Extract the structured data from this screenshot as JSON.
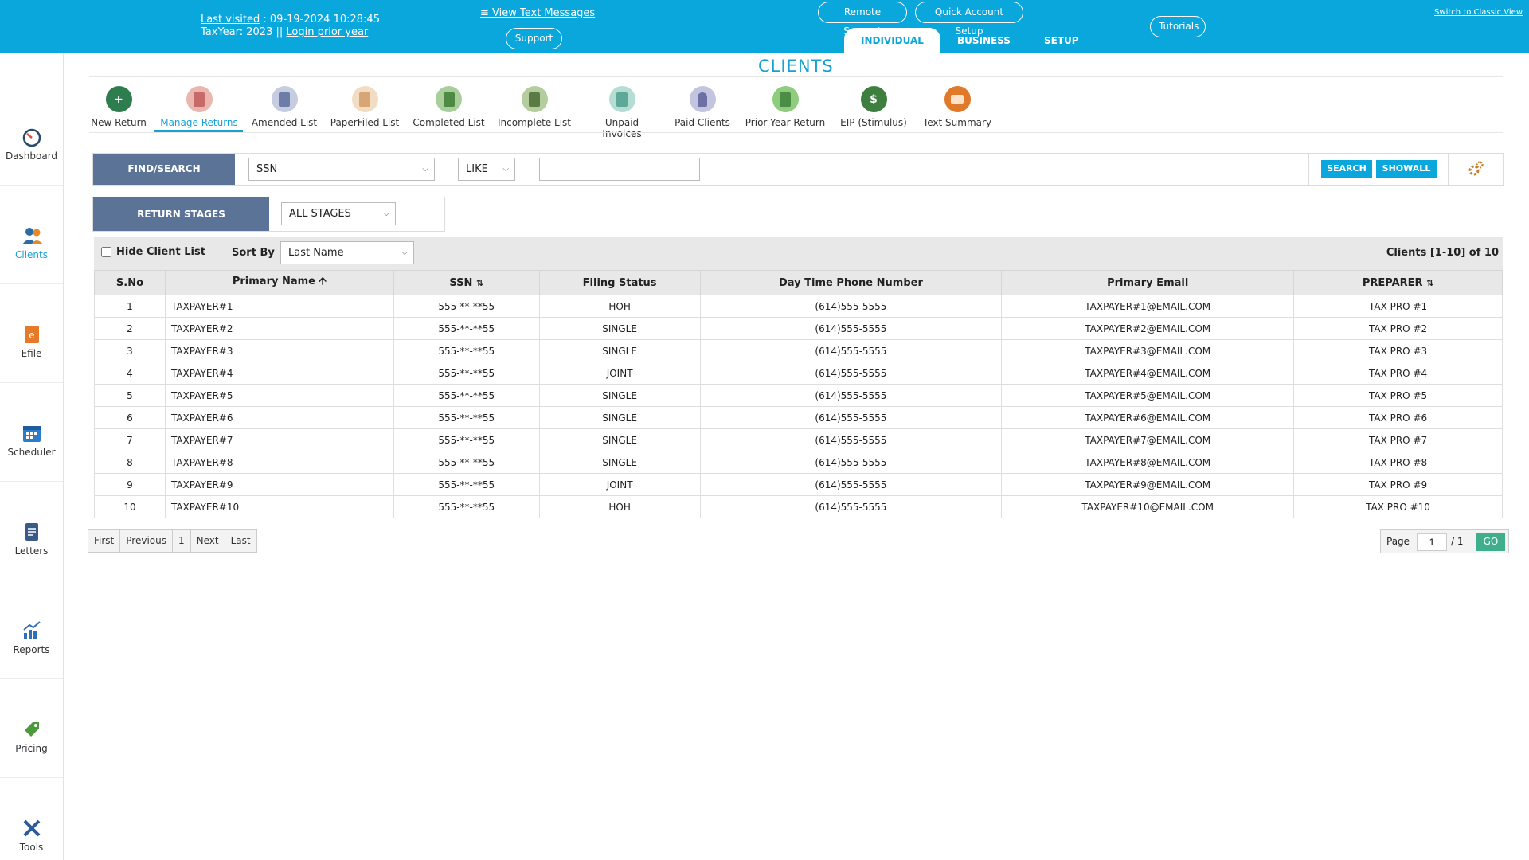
{
  "header": {
    "last_visited_label": "Last visited",
    "last_visited_value": ": 09-19-2024 10:28:45",
    "taxyear_label": "TaxYear:",
    "taxyear_value": "2023",
    "separator": "||",
    "login_prior_year": "Login prior year",
    "view_text_messages": "≡ View Text Messages",
    "support": "Support",
    "remote_support": "Remote Support",
    "quick_account_setup": "Quick Account Setup",
    "tutorials": "Tutorials",
    "switch_classic": "Switch to Classic View",
    "tabs": [
      {
        "label": "INDIVIDUAL"
      },
      {
        "label": "BUSINESS"
      },
      {
        "label": "SETUP"
      }
    ]
  },
  "sidebar": {
    "items": [
      {
        "label": "Dashboard",
        "icon": "speedometer-icon"
      },
      {
        "label": "Clients",
        "icon": "users-icon"
      },
      {
        "label": "Efile",
        "icon": "efile-icon"
      },
      {
        "label": "Scheduler",
        "icon": "calendar-icon"
      },
      {
        "label": "Letters",
        "icon": "document-icon"
      },
      {
        "label": "Reports",
        "icon": "chart-icon"
      },
      {
        "label": "Pricing",
        "icon": "price-tag-icon"
      },
      {
        "label": "Tools",
        "icon": "tools-icon"
      }
    ]
  },
  "page_title": "CLIENTS",
  "toolbar": {
    "items": [
      {
        "label": "New Return",
        "icon": "new-return-icon",
        "color": "#2e7d4f"
      },
      {
        "label": "Manage Returns",
        "icon": "manage-returns-icon",
        "color": "#c96a6a"
      },
      {
        "label": "Amended List",
        "icon": "amended-list-icon",
        "color": "#6c7ea8"
      },
      {
        "label": "PaperFiled List",
        "icon": "paperfiled-list-icon",
        "color": "#d8a675"
      },
      {
        "label": "Completed List",
        "icon": "completed-list-icon",
        "color": "#4f8a45"
      },
      {
        "label": "Incomplete List",
        "icon": "incomplete-list-icon",
        "color": "#5b7a45"
      },
      {
        "label": "Unpaid Invoices",
        "icon": "unpaid-invoices-icon",
        "color": "#5ea89a"
      },
      {
        "label": "Paid Clients",
        "icon": "paid-clients-icon",
        "color": "#6d6fa5"
      },
      {
        "label": "Prior Year Return",
        "icon": "prior-year-return-icon",
        "color": "#4c8d46"
      },
      {
        "label": "EIP (Stimulus)",
        "icon": "dollar-icon",
        "color": "#3e7e3e"
      },
      {
        "label": "Text Summary",
        "icon": "text-summary-icon",
        "color": "#e07a2a"
      }
    ]
  },
  "search": {
    "label": "FIND/SEARCH",
    "field": "SSN",
    "operator": "LIKE",
    "value": "",
    "search_button": "SEARCH",
    "showall_button": "SHOWALL"
  },
  "stages": {
    "label": "RETURN STAGES",
    "value": "ALL STAGES"
  },
  "list": {
    "hide_label": "Hide Client List",
    "sort_label": "Sort By",
    "sort_value": "Last Name",
    "count_text": "Clients [1-10] of 10",
    "columns": [
      "S.No",
      "Primary Name",
      "SSN",
      "Filing Status",
      "Day Time Phone Number",
      "Primary Email",
      "PREPARER"
    ],
    "rows": [
      {
        "sno": "1",
        "name": "TAXPAYER#1",
        "ssn": "555-**-**55",
        "status": "HOH",
        "phone": "(614)555-5555",
        "email": "TAXPAYER#1@EMAIL.COM",
        "preparer": "TAX PRO #1"
      },
      {
        "sno": "2",
        "name": "TAXPAYER#2",
        "ssn": "555-**-**55",
        "status": "SINGLE",
        "phone": "(614)555-5555",
        "email": "TAXPAYER#2@EMAIL.COM",
        "preparer": "TAX PRO #2"
      },
      {
        "sno": "3",
        "name": "TAXPAYER#3",
        "ssn": "555-**-**55",
        "status": "SINGLE",
        "phone": "(614)555-5555",
        "email": "TAXPAYER#3@EMAIL.COM",
        "preparer": "TAX PRO #3"
      },
      {
        "sno": "4",
        "name": "TAXPAYER#4",
        "ssn": "555-**-**55",
        "status": "JOINT",
        "phone": "(614)555-5555",
        "email": "TAXPAYER#4@EMAIL.COM",
        "preparer": "TAX PRO #4"
      },
      {
        "sno": "5",
        "name": "TAXPAYER#5",
        "ssn": "555-**-**55",
        "status": "SINGLE",
        "phone": "(614)555-5555",
        "email": "TAXPAYER#5@EMAIL.COM",
        "preparer": "TAX PRO #5"
      },
      {
        "sno": "6",
        "name": "TAXPAYER#6",
        "ssn": "555-**-**55",
        "status": "SINGLE",
        "phone": "(614)555-5555",
        "email": "TAXPAYER#6@EMAIL.COM",
        "preparer": "TAX PRO #6"
      },
      {
        "sno": "7",
        "name": "TAXPAYER#7",
        "ssn": "555-**-**55",
        "status": "SINGLE",
        "phone": "(614)555-5555",
        "email": "TAXPAYER#7@EMAIL.COM",
        "preparer": "TAX PRO #7"
      },
      {
        "sno": "8",
        "name": "TAXPAYER#8",
        "ssn": "555-**-**55",
        "status": "SINGLE",
        "phone": "(614)555-5555",
        "email": "TAXPAYER#8@EMAIL.COM",
        "preparer": "TAX PRO #8"
      },
      {
        "sno": "9",
        "name": "TAXPAYER#9",
        "ssn": "555-**-**55",
        "status": "JOINT",
        "phone": "(614)555-5555",
        "email": "TAXPAYER#9@EMAIL.COM",
        "preparer": "TAX PRO #9"
      },
      {
        "sno": "10",
        "name": "TAXPAYER#10",
        "ssn": "555-**-**55",
        "status": "HOH",
        "phone": "(614)555-5555",
        "email": "TAXPAYER#10@EMAIL.COM",
        "preparer": "TAX PRO #10"
      }
    ]
  },
  "pagination": {
    "first": "First",
    "previous": "Previous",
    "current": "1",
    "next": "Next",
    "last": "Last",
    "page_label": "Page",
    "page_value": "1",
    "page_total": "/ 1",
    "go": "GO"
  },
  "colors": {
    "header_bg": "#0aa7dd",
    "accent": "#18a2d4",
    "label_block": "#5a7397",
    "go_button": "#3fae8c"
  }
}
